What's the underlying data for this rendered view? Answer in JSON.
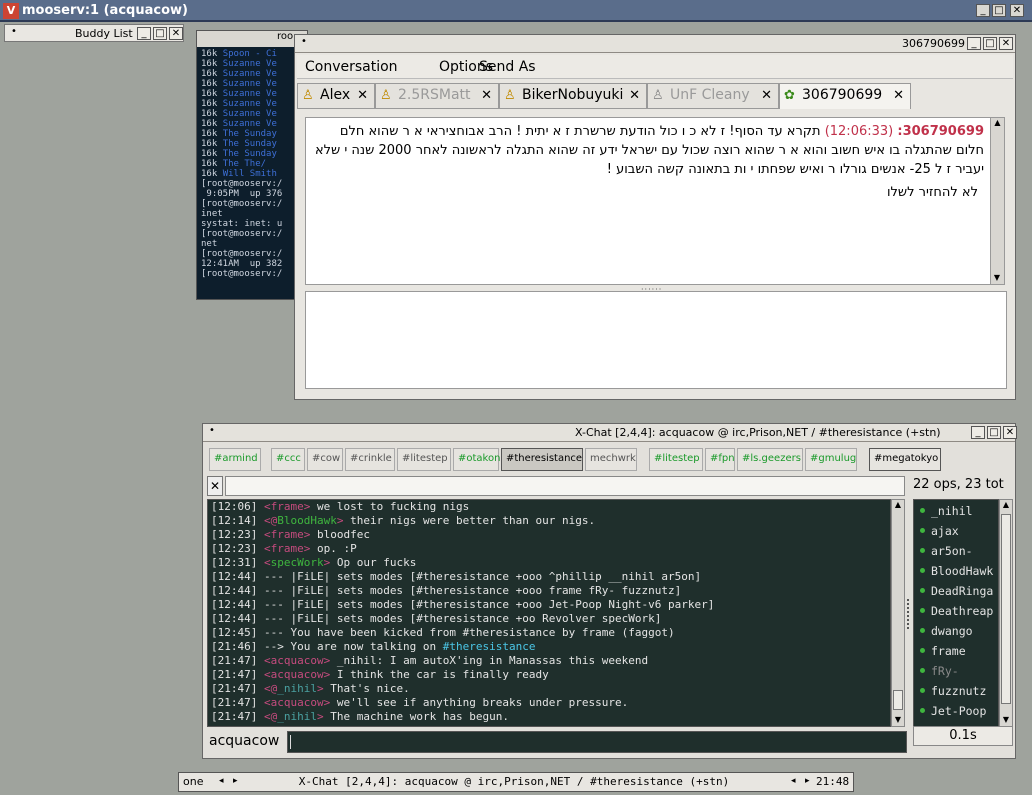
{
  "root": {
    "title": "mooserv:1 (acquacow)",
    "icon": "V"
  },
  "buddy_list": {
    "title": "Buddy List"
  },
  "terminal": {
    "title": "roo",
    "lines": [
      "16k Spoon - Ci",
      "16k Suzanne Ve",
      "16k Suzanne Ve",
      "16k Suzanne Ve",
      "16k Suzanne Ve",
      "16k Suzanne Ve",
      "16k Suzanne Ve",
      "16k Suzanne Ve",
      "16k The Sunday",
      "16k The Sunday",
      "16k The Sunday",
      "16k The The/",
      "16k Will Smith",
      "[root@mooserv:/",
      " 9:05PM  up 376",
      "[root@mooserv:/",
      "inet",
      "systat: inet: u",
      "[root@mooserv:/",
      "net",
      "[root@mooserv:/",
      "12:41AM  up 382",
      "[root@mooserv:/"
    ]
  },
  "conversation": {
    "window_number": "306790699",
    "menus": [
      "Conversation",
      "Options",
      "Send As"
    ],
    "tabs": [
      {
        "label": "Alex",
        "state": "normal"
      },
      {
        "label": "2.5RSMatt",
        "state": "away"
      },
      {
        "label": "BikerNobuyuki",
        "state": "normal"
      },
      {
        "label": "UnF Cleany",
        "state": "away"
      },
      {
        "label": "306790699",
        "state": "active"
      }
    ],
    "message": {
      "sender": "306790699",
      "time": "(12:06:33)",
      "text": "תקרא עד הסוף! ז לא כ ו כול הודעת שרשרת ז א יתית ! הרב אבוחציראי א ר שהוא חלם חלום שהתגלה בו איש חשוב והוא א ר שהוא רוצה שכול עם ישראל ידע  זה שהוא התגלה לראשונה לאחר 2000 שנה  י שלא יעביר ז ל 25- אנשים גורלו ר ואיש  שפחתו י ות בתאונה קשה השבוע !",
      "text2": "לא להחזיר לשלו"
    }
  },
  "xchat": {
    "title": "X-Chat [2,4,4]: acquacow @ irc,Prison,NET / #theresistance (+stn)",
    "channels": [
      {
        "label": "#armind",
        "kind": "green"
      },
      {
        "label": "#ccc",
        "kind": "green"
      },
      {
        "label": "#cow",
        "kind": "grey"
      },
      {
        "label": "#crinkle",
        "kind": "grey"
      },
      {
        "label": "#litestep",
        "kind": "grey"
      },
      {
        "label": "#otakon",
        "kind": "green"
      },
      {
        "label": "#theresistance",
        "kind": "active"
      },
      {
        "label": "mechwrk",
        "kind": "grey"
      },
      {
        "label": "#litestep",
        "kind": "green"
      },
      {
        "label": "#fpn",
        "kind": "green"
      },
      {
        "label": "#ls.geezers",
        "kind": "green"
      },
      {
        "label": "#gmulug",
        "kind": "green"
      },
      {
        "label": "#megatokyo",
        "kind": "active"
      }
    ],
    "user_count": "22 ops, 23 tot",
    "messages": [
      {
        "time": "[12:06]",
        "prefix": "<",
        "nick": "frame",
        "suffix": ">",
        "text": " we lost to fucking nigs",
        "nick_class": "nick"
      },
      {
        "time": "[12:14]",
        "prefix": "<@",
        "nick": "BloodHawk",
        "suffix": ">",
        "text": " their nigs were better than our nigs.",
        "nick_class": "nick-blood"
      },
      {
        "time": "[12:23]",
        "prefix": "<",
        "nick": "frame",
        "suffix": ">",
        "text": " bloodfec",
        "nick_class": "nick"
      },
      {
        "time": "[12:23]",
        "prefix": "<",
        "nick": "frame",
        "suffix": ">",
        "text": " op. :P",
        "nick_class": "nick"
      },
      {
        "time": "[12:31]",
        "prefix": "<",
        "nick": "specWork",
        "suffix": ">",
        "text": " Op our fucks",
        "nick_class": "nick-spec"
      },
      {
        "time": "[12:44]",
        "prefix": "",
        "nick": "",
        "suffix": "",
        "text": "--- |FiLE| sets modes [#theresistance +ooo ^phillip __nihil ar5on]",
        "nick_class": "sys"
      },
      {
        "time": "[12:44]",
        "prefix": "",
        "nick": "",
        "suffix": "",
        "text": "--- |FiLE| sets modes [#theresistance +ooo frame fRy- fuzznutz]",
        "nick_class": "sys"
      },
      {
        "time": "[12:44]",
        "prefix": "",
        "nick": "",
        "suffix": "",
        "text": "--- |FiLE| sets modes [#theresistance +ooo Jet-Poop Night-v6 parker]",
        "nick_class": "sys"
      },
      {
        "time": "[12:44]",
        "prefix": "",
        "nick": "",
        "suffix": "",
        "text": "--- |FiLE| sets modes [#theresistance +oo Revolver specWork]",
        "nick_class": "sys"
      },
      {
        "time": "[12:45]",
        "prefix": "",
        "nick": "",
        "suffix": "",
        "text": "--- You have been kicked from #theresistance by frame (faggot)",
        "nick_class": "sys"
      },
      {
        "time": "[21:46]",
        "prefix": "",
        "nick": "",
        "suffix": "",
        "text": "--> You are now talking on #theresistance",
        "nick_class": "sys"
      },
      {
        "time": "[21:47]",
        "prefix": "<",
        "nick": "acquacow",
        "suffix": ">",
        "text": " _nihil: I am autoX'ing in Manassas this weekend",
        "nick_class": "nick"
      },
      {
        "time": "[21:47]",
        "prefix": "<",
        "nick": "acquacow",
        "suffix": ">",
        "text": " I think the car is finally ready",
        "nick_class": "nick"
      },
      {
        "time": "[21:47]",
        "prefix": "<@",
        "nick": "_nihil",
        "suffix": ">",
        "text": " That's nice.",
        "nick_class": "nick-nihil"
      },
      {
        "time": "[21:47]",
        "prefix": "<",
        "nick": "acquacow",
        "suffix": ">",
        "text": " we'll see if anything breaks under pressure.",
        "nick_class": "nick"
      },
      {
        "time": "[21:47]",
        "prefix": "<@",
        "nick": "_nihil",
        "suffix": ">",
        "text": " The machine work has begun.",
        "nick_class": "nick-nihil"
      }
    ],
    "users": [
      {
        "name": "_nihil",
        "away": false
      },
      {
        "name": "ajax",
        "away": false
      },
      {
        "name": "ar5on-",
        "away": false
      },
      {
        "name": "BloodHawk",
        "away": false
      },
      {
        "name": "DeadRinga",
        "away": false
      },
      {
        "name": "Deathreap",
        "away": false
      },
      {
        "name": "dwango",
        "away": false
      },
      {
        "name": "frame",
        "away": false
      },
      {
        "name": "fRy-",
        "away": true
      },
      {
        "name": "fuzznutz",
        "away": false
      },
      {
        "name": "Jet-Poop",
        "away": false
      }
    ],
    "nickname": "acquacow",
    "lag": "0.1s"
  },
  "taskbar": {
    "desktop": "one",
    "task": "X-Chat [2,4,4]: acquacow @ irc,Prison,NET / #theresistance (+stn)",
    "clock": "21:48"
  }
}
